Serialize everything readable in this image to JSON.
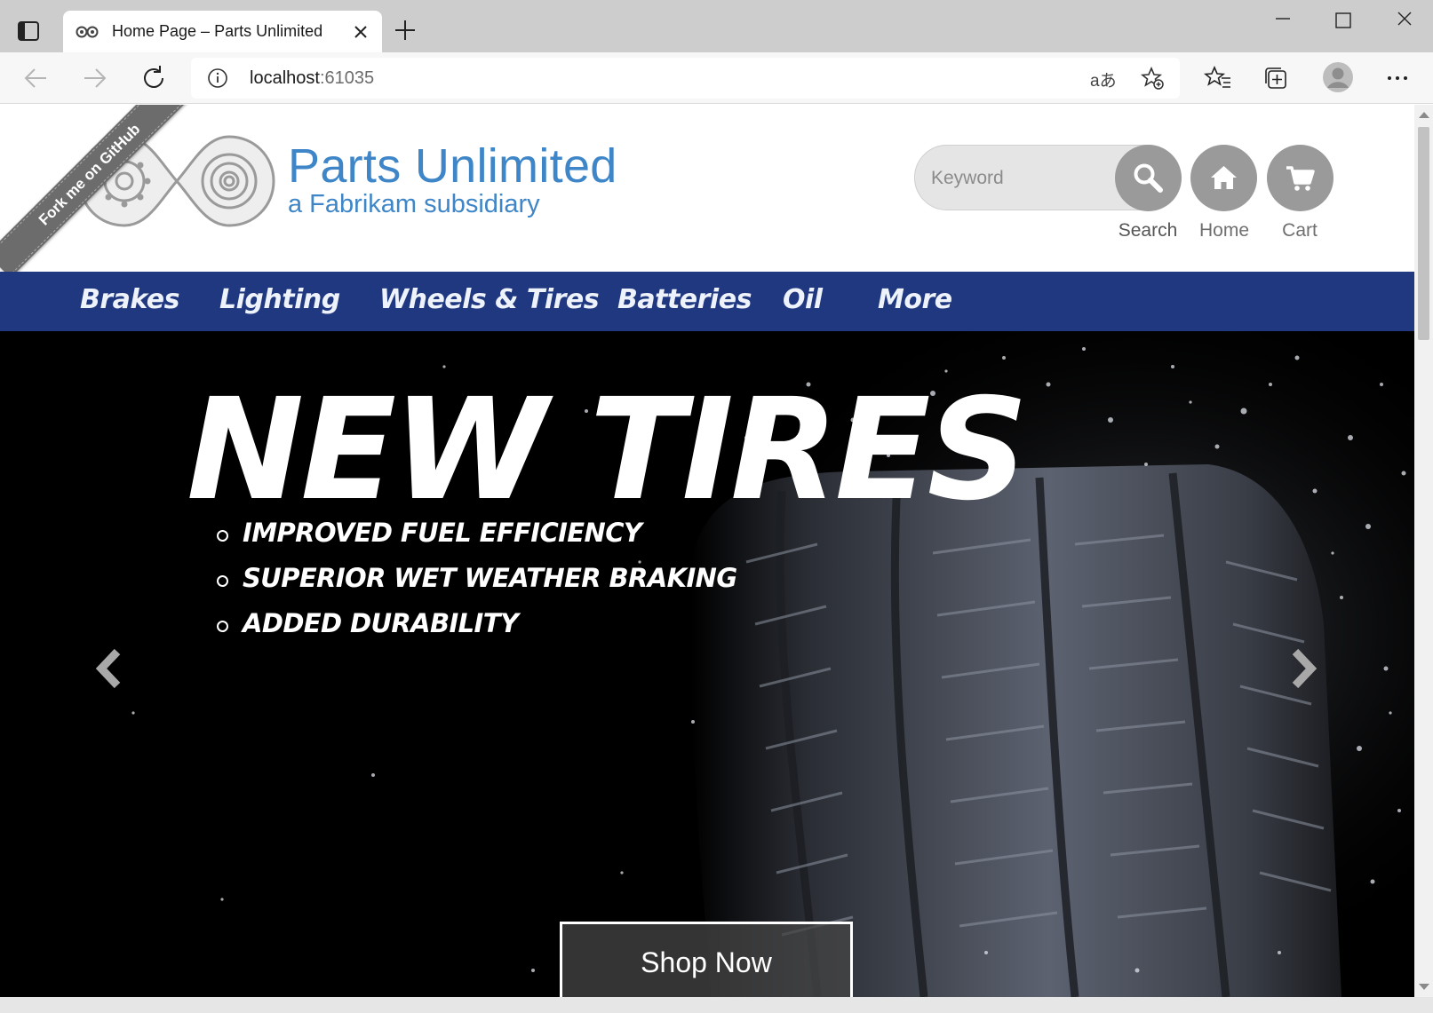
{
  "browser": {
    "tab": {
      "title": "Home Page – Parts Unlimited"
    },
    "address": {
      "host": "localhost",
      "port": ":61035"
    },
    "translate_glyph": "aあ"
  },
  "site": {
    "ribbon": "Fork me on GitHub",
    "brand": {
      "name": "Parts Unlimited",
      "subtitle": "a Fabrikam subsidiary"
    },
    "search": {
      "placeholder": "Keyword",
      "label": "Search"
    },
    "home_label": "Home",
    "cart_label": "Cart",
    "nav": [
      "Brakes",
      "Lighting",
      "Wheels & Tires",
      "Batteries",
      "Oil",
      "More"
    ],
    "hero": {
      "title": "NEW TIRES",
      "bullets": [
        "IMPROVED FUEL EFFICIENCY",
        "SUPERIOR WET WEATHER BRAKING",
        "ADDED DURABILITY"
      ],
      "cta": "Shop Now",
      "slide_count": 3,
      "active_slide": 2
    }
  },
  "colors": {
    "brand_blue": "#3f86c8",
    "nav_bg": "#1f3880",
    "button_gray": "#9a9a9a"
  },
  "icons": [
    "sidebar-icon",
    "tab-favicon",
    "close-icon",
    "plus-icon",
    "minimize-icon",
    "maximize-icon",
    "back-icon",
    "forward-icon",
    "reload-icon",
    "info-icon",
    "read-aloud-icon",
    "add-favorite-icon",
    "favorites-icon",
    "collections-icon",
    "profile-icon",
    "more-icon",
    "search-icon",
    "home-icon",
    "cart-icon",
    "chevron-left-icon",
    "chevron-right-icon"
  ]
}
